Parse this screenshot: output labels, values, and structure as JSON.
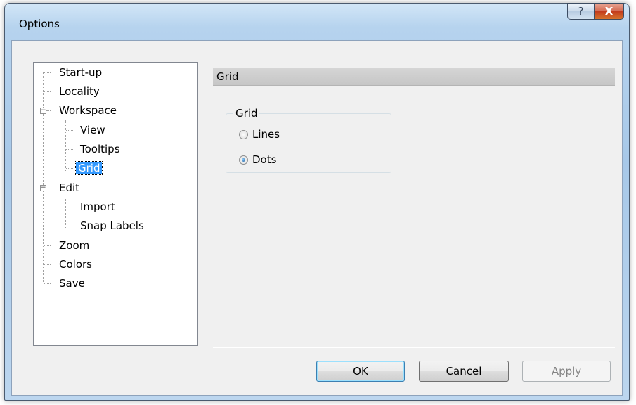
{
  "window": {
    "title": "Options",
    "help_glyph": "?",
    "close_glyph": "X"
  },
  "tree": {
    "items": [
      {
        "label": "Start-up"
      },
      {
        "label": "Locality"
      },
      {
        "label": "Workspace",
        "expander": "−"
      },
      {
        "label": "View"
      },
      {
        "label": "Tooltips"
      },
      {
        "label": "Grid",
        "selected": true
      },
      {
        "label": "Edit",
        "expander": "−"
      },
      {
        "label": "Import"
      },
      {
        "label": "Snap Labels"
      },
      {
        "label": "Zoom"
      },
      {
        "label": "Colors"
      },
      {
        "label": "Save"
      }
    ]
  },
  "panel": {
    "header": "Grid",
    "group_title": "Grid",
    "options": [
      {
        "label": "Lines",
        "checked": false
      },
      {
        "label": "Dots",
        "checked": true
      }
    ]
  },
  "buttons": {
    "ok": "OK",
    "cancel": "Cancel",
    "apply": "Apply"
  },
  "colors": {
    "selection": "#3399ff",
    "frame": "#a7c8e8"
  }
}
